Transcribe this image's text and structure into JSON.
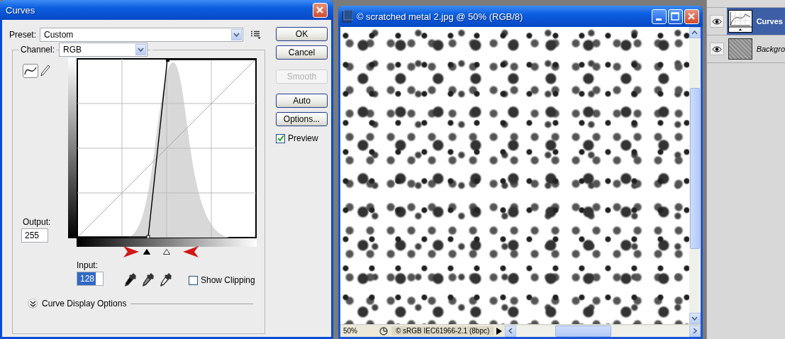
{
  "dialog": {
    "title": "Curves",
    "preset_label": "Preset:",
    "preset_value": "Custom",
    "channel_label": "Channel:",
    "channel_value": "RGB",
    "output_label": "Output:",
    "output_value": "255",
    "input_label": "Input:",
    "input_value": "128",
    "show_clipping": {
      "label": "Show Clipping",
      "checked": false
    },
    "curve_display_options": "Curve Display Options",
    "input_sliders": [
      {
        "kind": "shadow",
        "level": 0.39
      },
      {
        "kind": "highlight",
        "level": 0.5
      }
    ],
    "buttons": [
      {
        "label": "OK",
        "disabled": false
      },
      {
        "label": "Cancel",
        "disabled": false
      },
      {
        "label": "Smooth",
        "disabled": true
      },
      {
        "label": "Auto",
        "disabled": false
      },
      {
        "label": "Options...",
        "disabled": false
      }
    ],
    "preview": {
      "label": "Preview",
      "checked": true
    }
  },
  "document": {
    "title": "© scratched metal 2.jpg @ 50% (RGB/8)",
    "zoom": "50%",
    "status": "© sRGB IEC61966-2.1 (8bpc)"
  },
  "layers": [
    {
      "name": "Curves",
      "kind": "adjustment",
      "selected": true
    },
    {
      "name": "Backgro",
      "kind": "image",
      "selected": false
    }
  ]
}
